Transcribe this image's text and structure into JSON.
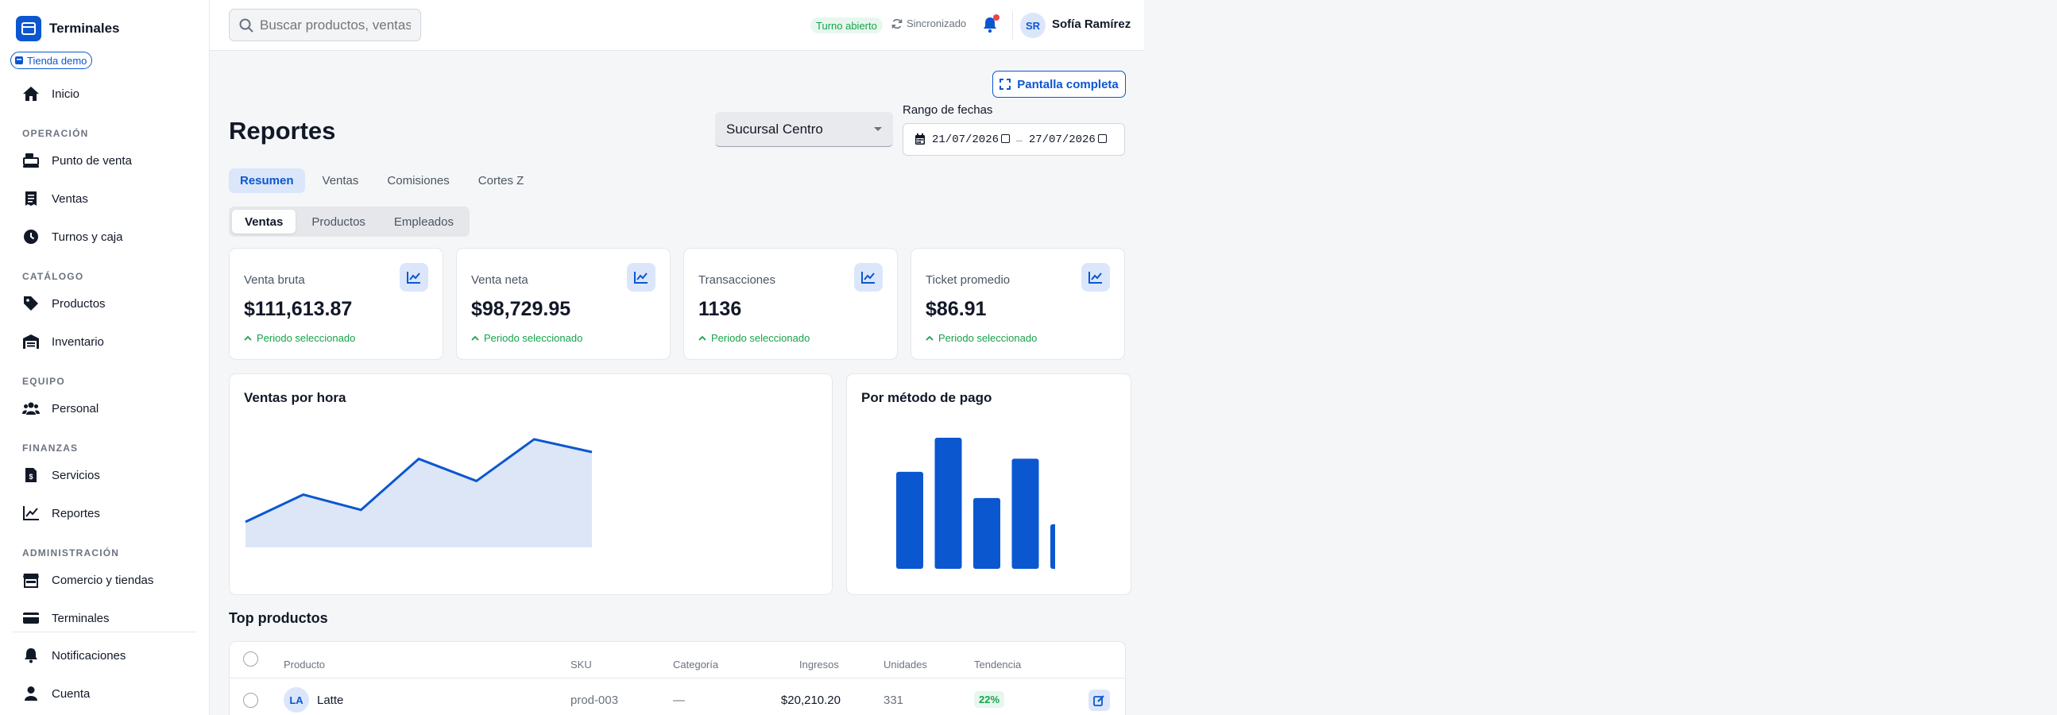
{
  "sidebar": {
    "brand": "Terminales",
    "store_badge": "Tienda demo",
    "items": {
      "inicio": "Inicio",
      "punto_venta": "Punto de venta",
      "ventas": "Ventas",
      "turnos": "Turnos y caja",
      "productos": "Productos",
      "inventario": "Inventario",
      "personal": "Personal",
      "servicios": "Servicios",
      "reportes": "Reportes",
      "comercio": "Comercio y tiendas",
      "terminales": "Terminales",
      "notificaciones": "Notificaciones",
      "cuenta": "Cuenta"
    },
    "sections": {
      "operacion": "OPERACIÓN",
      "catalogo": "CATÁLOGO",
      "equipo": "EQUIPO",
      "finanzas": "FINANZAS",
      "administracion": "ADMINISTRACIÓN"
    }
  },
  "topbar": {
    "search_placeholder": "Buscar productos, ventas…",
    "shift_status": "Turno abierto",
    "sync_status": "Sincronizado",
    "user_initials": "SR",
    "user_name": "Sofía Ramírez"
  },
  "main": {
    "fullscreen_label": "Pantalla completa",
    "title": "Reportes",
    "branch": "Sucursal Centro",
    "range_label": "Rango de fechas",
    "date_from": "21/07/2026",
    "date_to": "27/07/2026",
    "range_separator": "–",
    "tabs": [
      "Resumen",
      "Ventas",
      "Comisiones",
      "Cortes Z"
    ],
    "subtabs": [
      "Ventas",
      "Productos",
      "Empleados"
    ],
    "kpis": [
      {
        "label": "Venta bruta",
        "value": "$111,613.87",
        "foot": "Periodo seleccionado"
      },
      {
        "label": "Venta neta",
        "value": "$98,729.95",
        "foot": "Periodo seleccionado"
      },
      {
        "label": "Transacciones",
        "value": "1136",
        "foot": "Periodo seleccionado"
      },
      {
        "label": "Ticket promedio",
        "value": "$86.91",
        "foot": "Periodo seleccionado"
      }
    ],
    "hourly_title": "Ventas por hora",
    "payment_title": "Por método de pago",
    "top_products_title": "Top productos",
    "table": {
      "headers": {
        "producto": "Producto",
        "sku": "SKU",
        "categoria": "Categoría",
        "ingresos": "Ingresos",
        "unidades": "Unidades",
        "tendencia": "Tendencia"
      },
      "rows": [
        {
          "initials": "LA",
          "name": "Latte",
          "sku": "prod-003",
          "category": "—",
          "revenue": "$20,210.20",
          "units": "331",
          "trend": "22%"
        }
      ]
    }
  },
  "chart_data": [
    {
      "type": "area",
      "title": "Ventas por hora",
      "x": [
        1,
        2,
        3,
        4,
        5,
        6,
        7
      ],
      "values": [
        30,
        62,
        44,
        104,
        78,
        127,
        112
      ],
      "ylim": [
        0,
        140
      ],
      "color": "#0b57d0",
      "fill": "#dde6f7"
    },
    {
      "type": "bar",
      "title": "Por método de pago",
      "categories": [
        "1",
        "2",
        "3",
        "4",
        "5"
      ],
      "values": [
        74,
        100,
        54,
        84,
        34
      ],
      "ylim": [
        0,
        100
      ],
      "color": "#0b57d0"
    }
  ],
  "colors": {
    "accent": "#0b57d0",
    "success": "#16a34a",
    "danger": "#ef4444"
  }
}
